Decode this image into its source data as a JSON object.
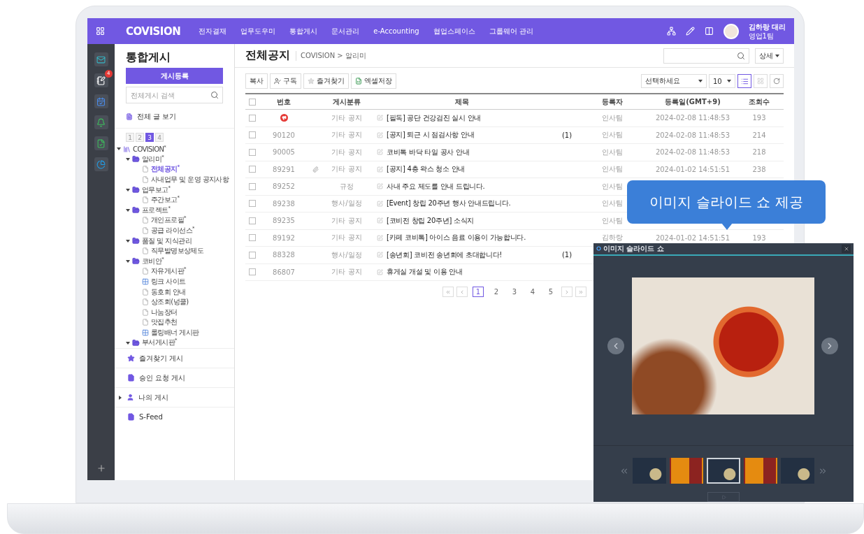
{
  "topbar": {
    "logo": "COVISION",
    "menu": [
      "전자결재",
      "업무도우미",
      "통합게시",
      "문서관리",
      "e-Accounting",
      "협업스페이스",
      "그룹웨어 관리"
    ],
    "user": {
      "name": "김하랑 대리",
      "team": "영업1팀"
    }
  },
  "rail": {
    "items": [
      {
        "kind": "mail"
      },
      {
        "kind": "edit",
        "badge": "4"
      },
      {
        "kind": "calendar"
      },
      {
        "kind": "bell"
      },
      {
        "kind": "note"
      },
      {
        "kind": "chart"
      }
    ]
  },
  "sidebar": {
    "title": "통합게시",
    "register_button": "게시등록",
    "search": {
      "placeholder": "전체게시 검색"
    },
    "all_posts": "전체 글 보기",
    "pages": [
      {
        "label": "1",
        "selected": false
      },
      {
        "label": "2",
        "selected": false
      },
      {
        "label": "3",
        "selected": true
      },
      {
        "label": "4",
        "selected": false
      }
    ],
    "tree": [
      {
        "label": "COVISION$^{*}$",
        "kind": "root",
        "expanded": true,
        "children": [
          {
            "label": "알리미$^{*}$",
            "kind": "folder",
            "expanded": true,
            "children": [
              {
                "label": "전체공지$^{*}$",
                "kind": "page",
                "selected": true
              },
              {
                "label": "사내업무 및 운영 공지사항",
                "kind": "page",
                "selected": false
              }
            ]
          },
          {
            "label": "업무보고$^{*}$",
            "kind": "folder",
            "expanded": true,
            "children": [
              {
                "label": "주간보고$^{*}$",
                "kind": "page",
                "selected": false
              }
            ]
          },
          {
            "label": "프로젝트$^{*}$",
            "kind": "folder",
            "expanded": true,
            "children": [
              {
                "label": "개인프로필$^{*}$",
                "kind": "page",
                "selected": false
              },
              {
                "label": "공급 라이선스$^{*}$",
                "kind": "page",
                "selected": false
              }
            ]
          },
          {
            "label": "품질 및 지식관리",
            "kind": "folder",
            "expanded": true,
            "children": [
              {
                "label": "직무발명보상제도",
                "kind": "page",
                "selected": false
              }
            ]
          },
          {
            "label": "코비안$^{*}$",
            "kind": "folder",
            "expanded": true,
            "children": [
              {
                "label": "자유게시판$^{*}$",
                "kind": "page",
                "selected": false
              },
              {
                "label": "링크 사이트",
                "kind": "link",
                "selected": false
              },
              {
                "label": "동호회 안내",
                "kind": "page",
                "selected": false
              },
              {
                "label": "상조회(넝쿨)",
                "kind": "page",
                "selected": false
              },
              {
                "label": "나눔장터",
                "kind": "page",
                "selected": false
              },
              {
                "label": "맛집추천",
                "kind": "page",
                "selected": false
              },
              {
                "label": "롤링배너 게시판",
                "kind": "link",
                "selected": false
              }
            ]
          },
          {
            "label": "부서게시판$^{*}$",
            "kind": "folder",
            "expanded": true
          }
        ]
      }
    ],
    "footer_menu": [
      {
        "label": "즐겨찾기 게시",
        "kind": "star"
      },
      {
        "label": "승인 요청 게시",
        "kind": "approval"
      },
      {
        "label": "나의 게시",
        "kind": "person",
        "expanded": false
      },
      {
        "label": "S-Feed",
        "kind": "feed"
      }
    ]
  },
  "content": {
    "title": "전체공지",
    "breadcrumb": "COVISION > 알리미",
    "detail_button": "상세",
    "toolbar": [
      {
        "label": "복사",
        "kind": "plain"
      },
      {
        "label": "구독",
        "kind": "subscribe"
      },
      {
        "label": "즐겨찾기",
        "kind": "star"
      },
      {
        "label": "엑셀저장",
        "kind": "excel"
      }
    ],
    "category_select": "선택하세요",
    "page_size": "10",
    "views": [
      {
        "kind": "list",
        "selected": true
      },
      {
        "kind": "grid",
        "selected": false
      }
    ]
  },
  "table": {
    "all_checked": false,
    "columns": [
      "번호",
      "게시분류",
      "제목",
      "등록자",
      "등록일(GMT+9)",
      "조회수"
    ],
    "rows": [
      {
        "kind": "notice",
        "checked": false,
        "attachment": false,
        "category": "기타 공지",
        "title": "[필독] 공단 건강검진 실시 안내",
        "author": "인사팀",
        "date": "2024-02-08 11:48:53",
        "views": "193"
      },
      {
        "kind": "normal",
        "number": "90120",
        "checked": false,
        "attachment": false,
        "category": "기타 공지",
        "title": "[공지] 퇴근 시 점검사항 안내",
        "comments": "(1)",
        "author": "인사팀",
        "date": "2024-02-08 11:48:53",
        "views": "214"
      },
      {
        "kind": "normal",
        "number": "90005",
        "checked": false,
        "attachment": false,
        "category": "기타 공지",
        "title": "코비톡 바닥 타일 공사 안내",
        "author": "인사팀",
        "date": "2024-02-08 11:48:53",
        "views": "218"
      },
      {
        "kind": "normal",
        "number": "89291",
        "checked": false,
        "attachment": true,
        "category": "기타 공지",
        "title": "[공지] 4층 왁스 청소 안내",
        "author": "인사팀",
        "date": "2024-01-02 14:51:51",
        "views": "238"
      },
      {
        "kind": "normal",
        "number": "89252",
        "checked": false,
        "attachment": false,
        "category": "규정",
        "title": "사내 주요 제도를 안내 드립니다.",
        "author": "인사팀"
      },
      {
        "kind": "normal",
        "number": "89238",
        "checked": false,
        "attachment": false,
        "category": "행사/일정",
        "title": "[Event] 창립 20주년 행사 안내드립니다.",
        "author": "인사팀"
      },
      {
        "kind": "normal",
        "number": "89235",
        "checked": false,
        "attachment": false,
        "category": "기타 공지",
        "title": "[코비전 창립 20주년] 소식지",
        "author": "인사팀"
      },
      {
        "kind": "normal",
        "number": "89192",
        "checked": false,
        "attachment": false,
        "category": "기타 공지",
        "title": "[카페 코비톡] 아이스 음료 이용이 가능합니다.",
        "author": "김하랑",
        "date": "2024-01-02 14:51:51",
        "views": "193"
      },
      {
        "kind": "normal",
        "number": "88328",
        "checked": false,
        "attachment": false,
        "category": "행사/일정",
        "title": "[송년회] 코비전 송년회에 초대합니다!",
        "comments": "(1)"
      },
      {
        "kind": "normal",
        "number": "86807",
        "checked": false,
        "attachment": false,
        "category": "기타 공지",
        "title": "휴게실 개설 및 이용 안내"
      }
    ]
  },
  "pagination": [
    {
      "label": "1",
      "selected": true
    },
    {
      "label": "2",
      "selected": false
    },
    {
      "label": "3",
      "selected": false
    },
    {
      "label": "4",
      "selected": false
    },
    {
      "label": "5",
      "selected": false
    }
  ],
  "tooltip": "이미지 슬라이드 쇼 제공",
  "slideshow": {
    "title": "이미지 슬라이드 쇼",
    "thumbnails": [
      {
        "kind": "food",
        "selected": false
      },
      {
        "kind": "painting",
        "selected": false
      },
      {
        "kind": "food",
        "selected": true
      },
      {
        "kind": "painting",
        "selected": false
      },
      {
        "kind": "food",
        "selected": false
      }
    ]
  }
}
